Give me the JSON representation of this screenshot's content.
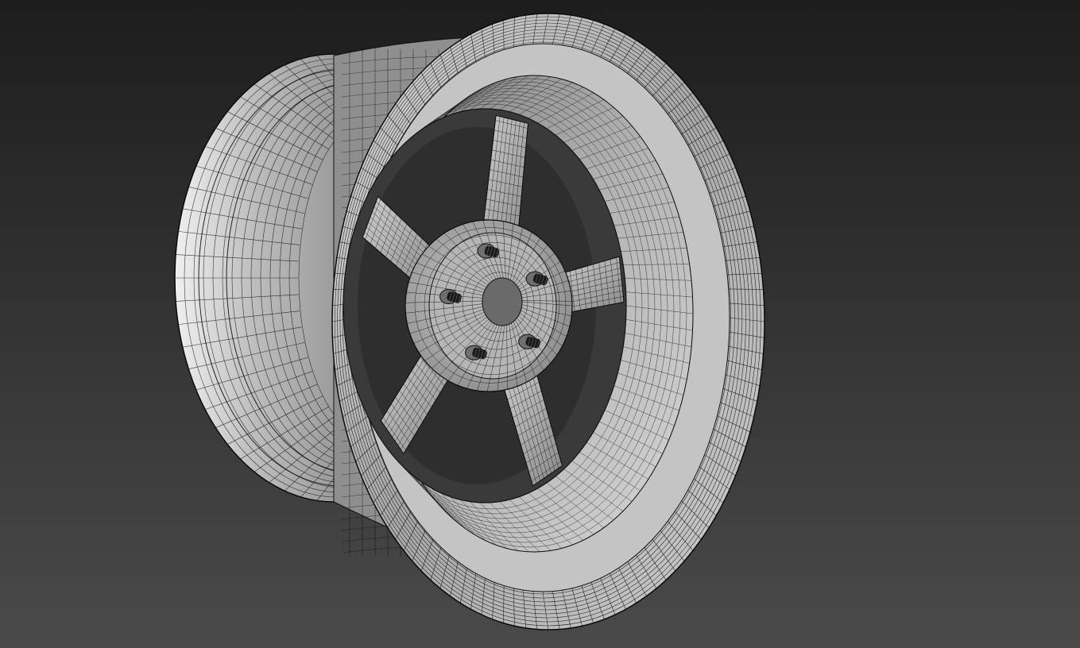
{
  "viewport": {
    "background_top": "#1d1d1d",
    "background_bottom": "#4a4a4a",
    "wire_color": "#000000",
    "surface_light": "#d9d9d9",
    "surface_mid": "#9a9a9a",
    "surface_dark": "#5a5a5a",
    "stud_color": "#1a1a1a"
  },
  "model": {
    "object": "wheel-rim",
    "spoke_count": 5,
    "lug_stud_count": 5,
    "display_mode": "wireframe-over-shaded"
  }
}
